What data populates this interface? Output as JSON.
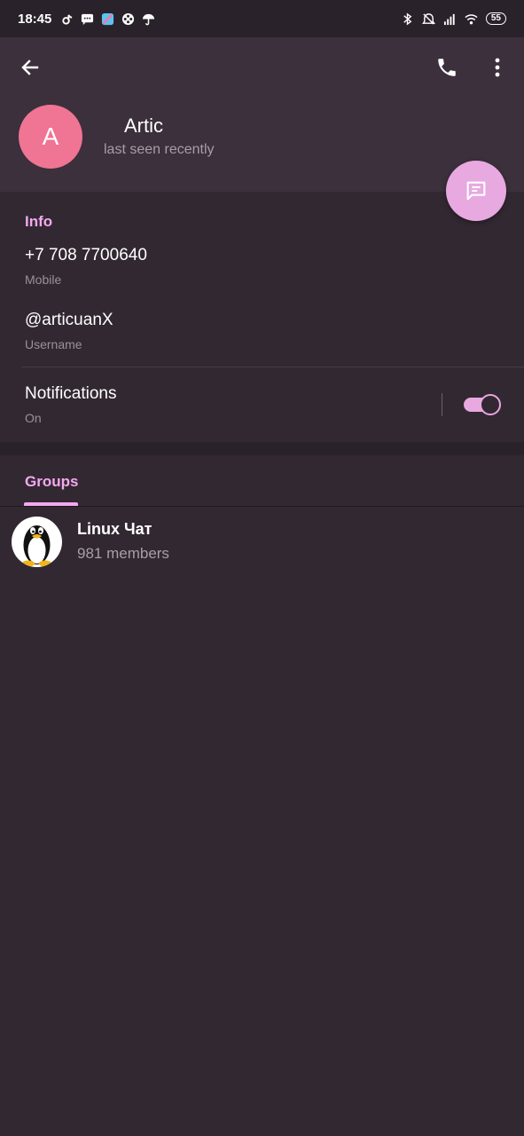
{
  "status_bar": {
    "time": "18:45",
    "battery": "55"
  },
  "header": {
    "avatar_letter": "A",
    "avatar_color": "#f07493",
    "name": "Artic",
    "last_seen": "last seen recently"
  },
  "info": {
    "section_label": "Info",
    "phone": "+7 708 7700640",
    "phone_label": "Mobile",
    "username": "@articuanX",
    "username_label": "Username",
    "notifications": "Notifications",
    "notifications_state": "On"
  },
  "tabs": {
    "groups_label": "Groups"
  },
  "groups": [
    {
      "name": "Linux Чат",
      "members": "981 members",
      "avatar_icon": "tux-penguin-icon"
    }
  ],
  "colors": {
    "background": "#322832",
    "header": "#3b303b",
    "accent": "#f4a8ef",
    "fab": "#e8a8e0"
  }
}
